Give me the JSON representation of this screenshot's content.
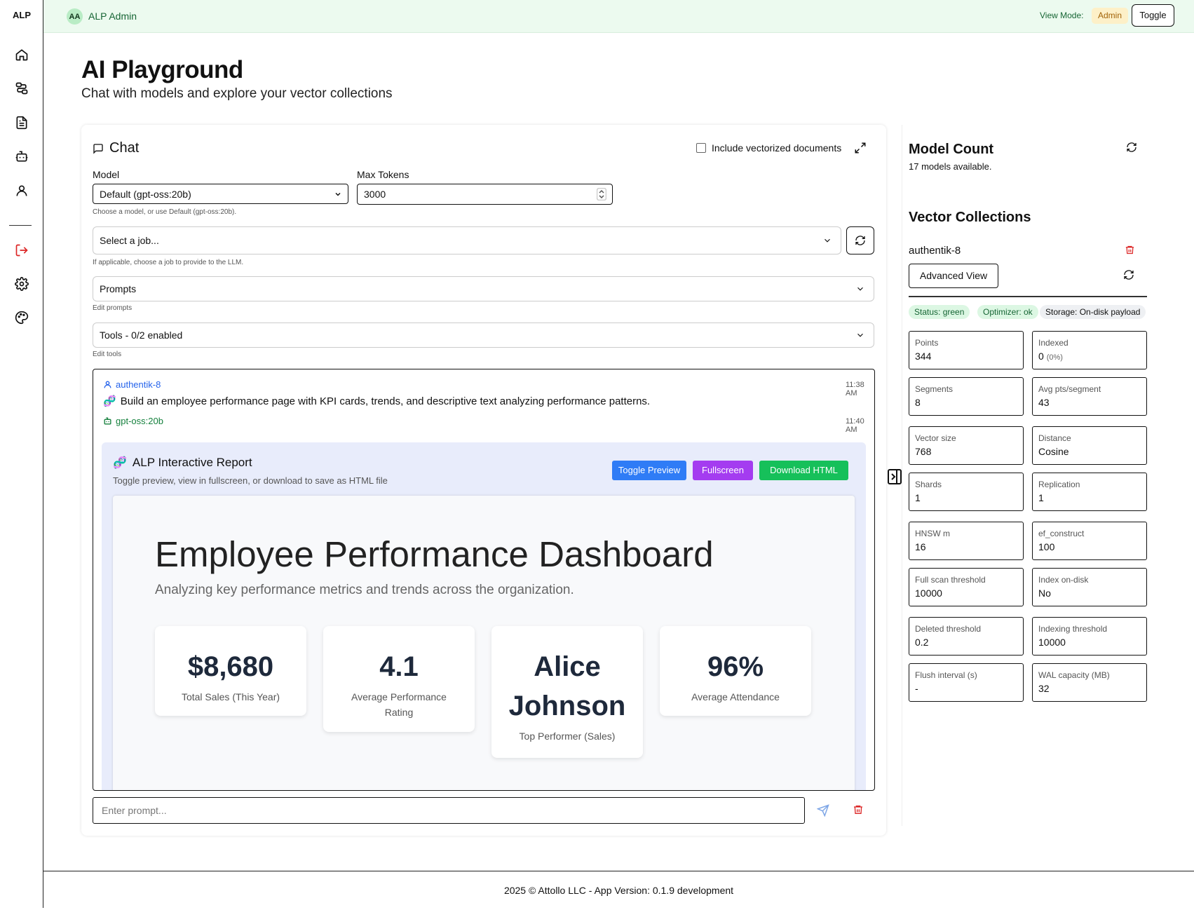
{
  "sidebar": {
    "brand": "ALP",
    "icons": [
      "home-icon",
      "workflow-icon",
      "document-icon",
      "bot-icon",
      "user-icon",
      "logout-icon",
      "gear-icon",
      "palette-icon"
    ]
  },
  "topbar": {
    "avatar_initials": "AA",
    "user_name": "ALP Admin",
    "view_mode_label": "View Mode:",
    "view_mode_value": "Admin",
    "toggle_label": "Toggle"
  },
  "page": {
    "title": "AI Playground",
    "subtitle": "Chat with models and explore your vector collections"
  },
  "chat": {
    "title": "Chat",
    "include_vectorized_label": "Include vectorized documents",
    "model_label": "Model",
    "model_value": "Default (gpt-oss:20b)",
    "model_hint": "Choose a model, or use Default (gpt-oss:20b).",
    "max_tokens_label": "Max Tokens",
    "max_tokens_value": "3000",
    "job_placeholder": "Select a job...",
    "job_hint": "If applicable, choose a job to provide to the LLM.",
    "prompts_label": "Prompts",
    "prompts_hint": "Edit prompts",
    "tools_label": "Tools - 0/2 enabled",
    "tools_hint": "Edit tools",
    "messages": [
      {
        "author": "authentik-8",
        "time": "11:38 AM",
        "text": "Build an employee performance page with KPI cards, trends, and descriptive text analyzing performance patterns."
      },
      {
        "author": "gpt-oss:20b",
        "time": "11:40 AM"
      }
    ],
    "report": {
      "title": "ALP Interactive Report",
      "subtitle": "Toggle preview, view in fullscreen, or download to save as HTML file",
      "btn_toggle_preview": "Toggle Preview",
      "btn_fullscreen": "Fullscreen",
      "btn_download": "Download HTML",
      "dashboard_title": "Employee Performance Dashboard",
      "dashboard_subtitle": "Analyzing key performance metrics and trends across the organization.",
      "kpis": [
        {
          "value": "$8,680",
          "label": "Total Sales (This Year)"
        },
        {
          "value": "4.1",
          "label": "Average Performance Rating"
        },
        {
          "value": "Alice Johnson",
          "label": "Top Performer (Sales)"
        },
        {
          "value": "96%",
          "label": "Average Attendance"
        }
      ]
    },
    "prompt_placeholder": "Enter prompt..."
  },
  "right_panel": {
    "model_count_title": "Model Count",
    "model_count_text": "17 models available.",
    "vector_title": "Vector Collections",
    "collection_name": "authentik-8",
    "advanced_view_label": "Advanced View",
    "tags": [
      "Status: green",
      "Optimizer: ok",
      "Storage: On-disk payload"
    ],
    "stats": [
      {
        "k": "Points",
        "v": "344"
      },
      {
        "k": "Indexed",
        "v": "0",
        "extra": "(0%)"
      },
      {
        "k": "Segments",
        "v": "8"
      },
      {
        "k": "Avg pts/segment",
        "v": "43"
      },
      {
        "k": "Vector size",
        "v": "768"
      },
      {
        "k": "Distance",
        "v": "Cosine"
      },
      {
        "k": "Shards",
        "v": "1"
      },
      {
        "k": "Replication",
        "v": "1"
      },
      {
        "k": "HNSW m",
        "v": "16"
      },
      {
        "k": "ef_construct",
        "v": "100"
      },
      {
        "k": "Full scan threshold",
        "v": "10000"
      },
      {
        "k": "Index on-disk",
        "v": "No"
      },
      {
        "k": "Deleted threshold",
        "v": "0.2"
      },
      {
        "k": "Indexing threshold",
        "v": "10000"
      },
      {
        "k": "Flush interval (s)",
        "v": "-"
      },
      {
        "k": "WAL capacity (MB)",
        "v": "32"
      }
    ]
  },
  "footer": "2025 © Attollo LLC - App Version: 0.1.9 development",
  "colors": {
    "topbar_bg": "#ecfaef",
    "blue": "#2f7cf6",
    "purple": "#a43cf0",
    "green": "#16c05a",
    "danger": "#dc2626"
  }
}
